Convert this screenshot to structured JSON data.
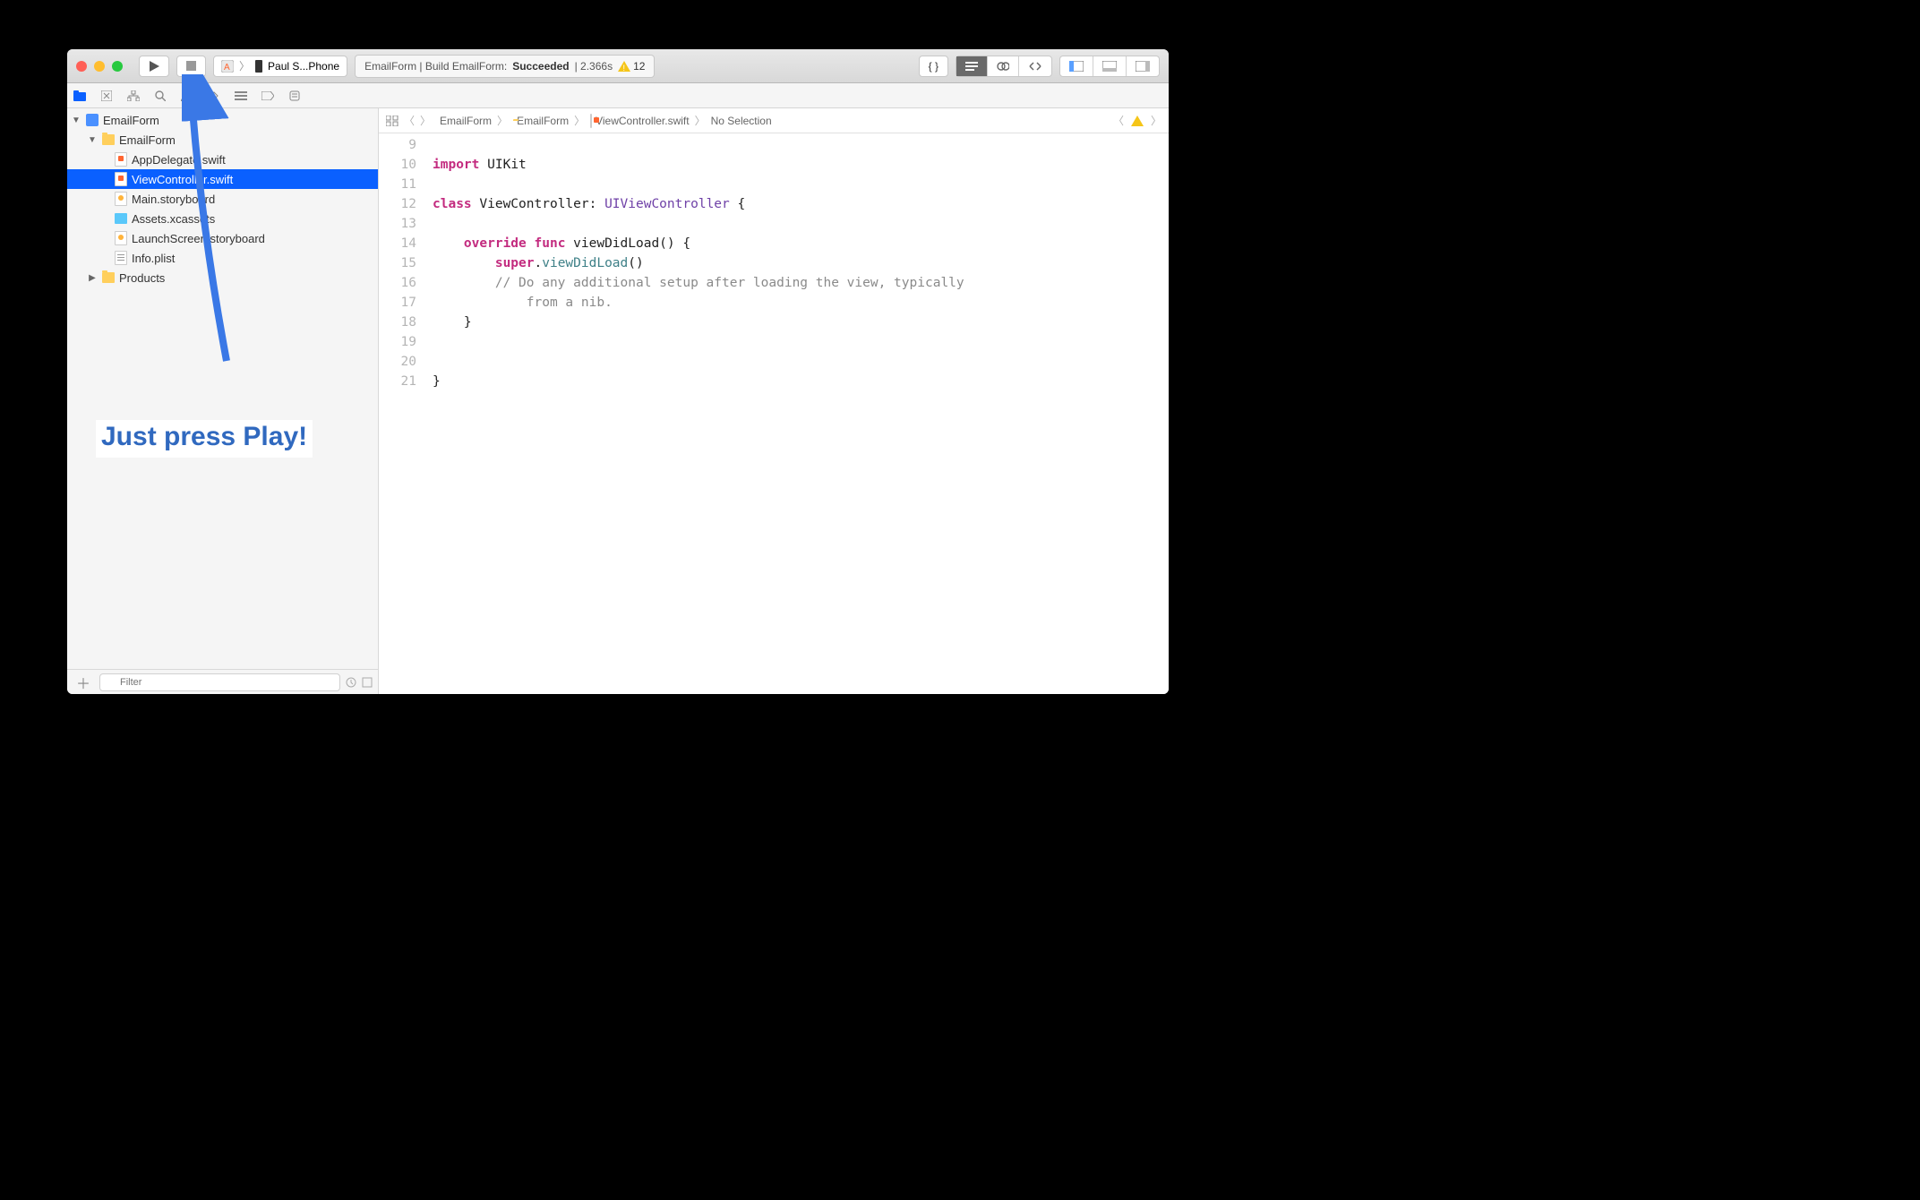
{
  "toolbar": {
    "scheme_text": "Paul S...Phone",
    "status_prefix": "EmailForm | Build EmailForm: ",
    "status_result": "Succeeded",
    "status_time": " | 2.366s",
    "warning_count": "12"
  },
  "navigator": {
    "project": "EmailForm",
    "target_folder": "EmailForm",
    "files": [
      {
        "name": "AppDelegate.swift",
        "kind": "swift"
      },
      {
        "name": "ViewController.swift",
        "kind": "swift",
        "selected": true
      },
      {
        "name": "Main.storyboard",
        "kind": "storyboard"
      },
      {
        "name": "Assets.xcassets",
        "kind": "assets"
      },
      {
        "name": "LaunchScreen.storyboard",
        "kind": "storyboard"
      },
      {
        "name": "Info.plist",
        "kind": "plist"
      }
    ],
    "products_folder": "Products",
    "filter_placeholder": "Filter"
  },
  "jumpbar": {
    "crumb1": "EmailForm",
    "crumb2": "EmailForm",
    "crumb3": "ViewController.swift",
    "crumb4": "No Selection"
  },
  "code": {
    "line_numbers": [
      "9",
      "10",
      "11",
      "12",
      "13",
      "14",
      "15",
      "",
      "16",
      "17",
      "18",
      "19",
      "20",
      "21"
    ],
    "l9_import": "import",
    "l9_module": "UIKit",
    "l11_class": "class",
    "l11_name": "ViewController: ",
    "l11_super": "UIViewController",
    "l11_brace": " {",
    "l13_override": "override",
    "l13_func": "func",
    "l13_sig": "viewDidLoad() {",
    "l14_super": "super",
    "l14_dot": ".",
    "l14_call": "viewDidLoad",
    "l14_paren": "()",
    "l15_comment": "// Do any additional setup after loading the view, typically",
    "l15b_comment": "from a nib.",
    "l16_brace": "}",
    "l19_brace": "}"
  },
  "annotation": {
    "text": "Just press Play!"
  }
}
